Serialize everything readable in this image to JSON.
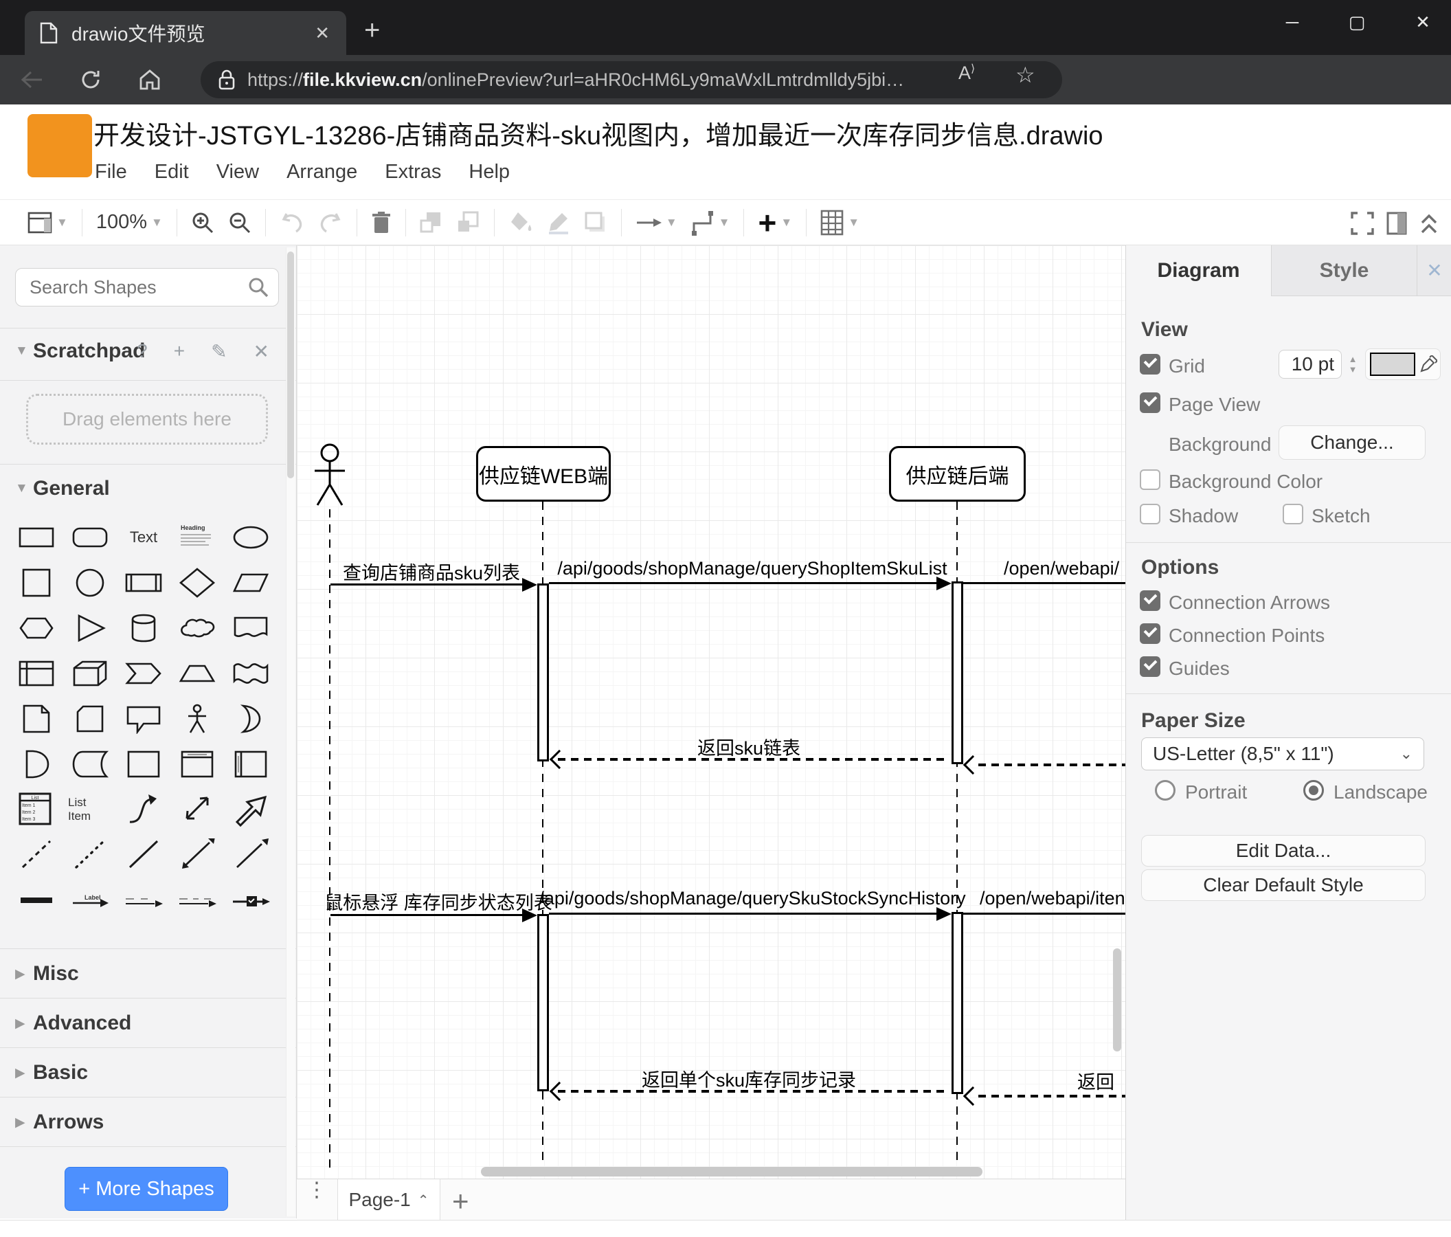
{
  "browser": {
    "tab_title": "drawio文件预览",
    "url_prefix": "https://",
    "url_domain": "file.kkview.cn",
    "url_path": "/onlinePreview?url=aHR0cHM6Ly9maWxlLmtrdmlldy5jbi…",
    "window_controls": {
      "minimize": "─",
      "maximize": "▢",
      "close": "✕"
    }
  },
  "app": {
    "doc_title": "开发设计-JSTGYL-13286-店铺商品资料-sku视图内，增加最近一次库存同步信息.drawio",
    "menus": [
      "File",
      "Edit",
      "View",
      "Arrange",
      "Extras",
      "Help"
    ],
    "zoom": "100%"
  },
  "sidebar": {
    "search_placeholder": "Search Shapes",
    "scratchpad_label": "Scratchpad",
    "drag_hint": "Drag elements here",
    "sections": {
      "general": "General",
      "misc": "Misc",
      "advanced": "Advanced",
      "basic": "Basic",
      "arrows": "Arrows"
    },
    "shapes": {
      "text": "Text",
      "heading": "Heading",
      "list": "List",
      "item1": "Item 1",
      "item2": "Item 2",
      "item3": "Item 3",
      "list_item": "List Item",
      "arrow_label": "Label"
    },
    "more_shapes": "+ More Shapes"
  },
  "diagram": {
    "participants": [
      {
        "label": "供应链WEB端"
      },
      {
        "label": "供应链后端"
      }
    ],
    "messages": [
      {
        "label": "查询店铺商品sku列表"
      },
      {
        "label": "/api/goods/shopManage/queryShopItemSkuList"
      },
      {
        "label": "/open/webapi/"
      },
      {
        "label": "返回sku链表"
      },
      {
        "label": "鼠标悬浮 库存同步状态列表"
      },
      {
        "label": "/api/goods/shopManage/querySkuStockSyncHistory"
      },
      {
        "label": "/open/webapi/iten"
      },
      {
        "label": "返回单个sku库存同步记录"
      },
      {
        "label": "返回"
      }
    ]
  },
  "panel": {
    "tabs": {
      "diagram": "Diagram",
      "style": "Style"
    },
    "view": {
      "heading": "View",
      "grid": "Grid",
      "grid_size": "10 pt",
      "page_view": "Page View",
      "background": "Background",
      "change": "Change...",
      "background_color": "Background Color",
      "shadow": "Shadow",
      "sketch": "Sketch"
    },
    "options": {
      "heading": "Options",
      "connection_arrows": "Connection Arrows",
      "connection_points": "Connection Points",
      "guides": "Guides"
    },
    "paper": {
      "heading": "Paper Size",
      "size": "US-Letter (8,5\" x 11\")",
      "portrait": "Portrait",
      "landscape": "Landscape"
    },
    "edit_data": "Edit Data...",
    "clear_default_style": "Clear Default Style"
  },
  "footer": {
    "page": "Page-1"
  },
  "colors": {
    "accent_blue": "#4D90FE",
    "logo_orange": "#F2931E",
    "chrome_dark": "#1c1c1e"
  }
}
